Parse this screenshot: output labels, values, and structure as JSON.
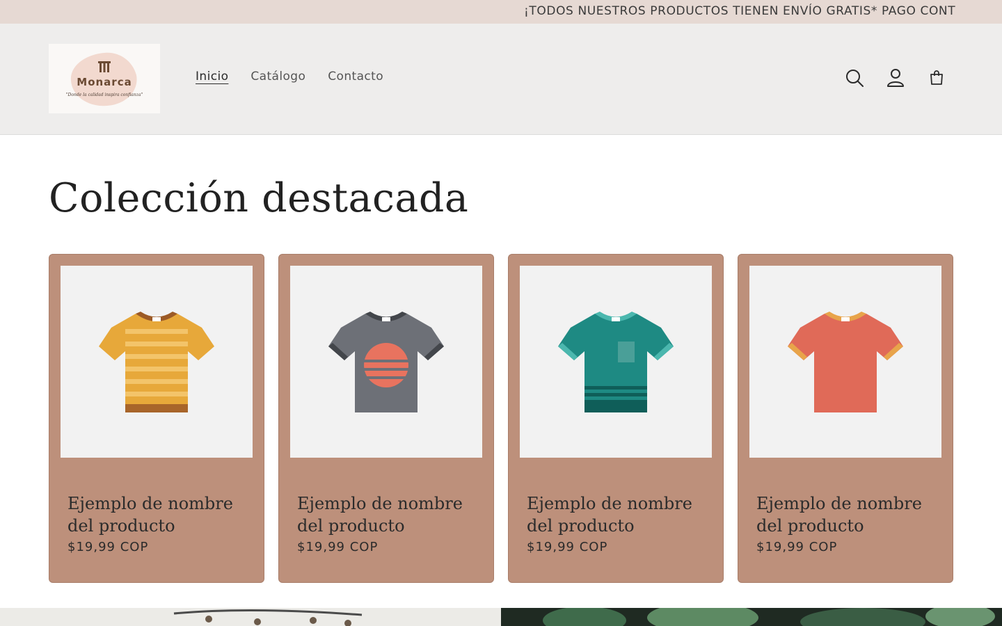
{
  "announcement": {
    "text": "¡TODOS NUESTROS PRODUCTOS TIENEN ENVÍO GRATIS* PAGO CONT"
  },
  "header": {
    "logo": {
      "name": "Monarca",
      "tagline": "\"Donde la calidad inspira confianza\""
    },
    "nav": [
      {
        "label": "Inicio",
        "active": true
      },
      {
        "label": "Catálogo",
        "active": false
      },
      {
        "label": "Contacto",
        "active": false
      }
    ],
    "icons": [
      "search-icon",
      "account-icon",
      "cart-icon"
    ]
  },
  "main": {
    "title": "Colección destacada",
    "products": [
      {
        "title": "Ejemplo de nombre del producto",
        "price": "$19,99 COP",
        "shirt_color": "#e7a83a",
        "accent_color": "#9c5a26"
      },
      {
        "title": "Ejemplo de nombre del producto",
        "price": "$19,99 COP",
        "shirt_color": "#6d7077",
        "accent_color": "#43464b"
      },
      {
        "title": "Ejemplo de nombre del producto",
        "price": "$19,99 COP",
        "shirt_color": "#1e8a83",
        "accent_color": "#4bb7ae"
      },
      {
        "title": "Ejemplo de nombre del producto",
        "price": "$19,99 COP",
        "shirt_color": "#e06a58",
        "accent_color": "#e8a44a"
      }
    ]
  },
  "colors": {
    "announcement_bg": "#e6d9d3",
    "header_bg": "#eeedec",
    "card_bg": "#bd907b"
  }
}
